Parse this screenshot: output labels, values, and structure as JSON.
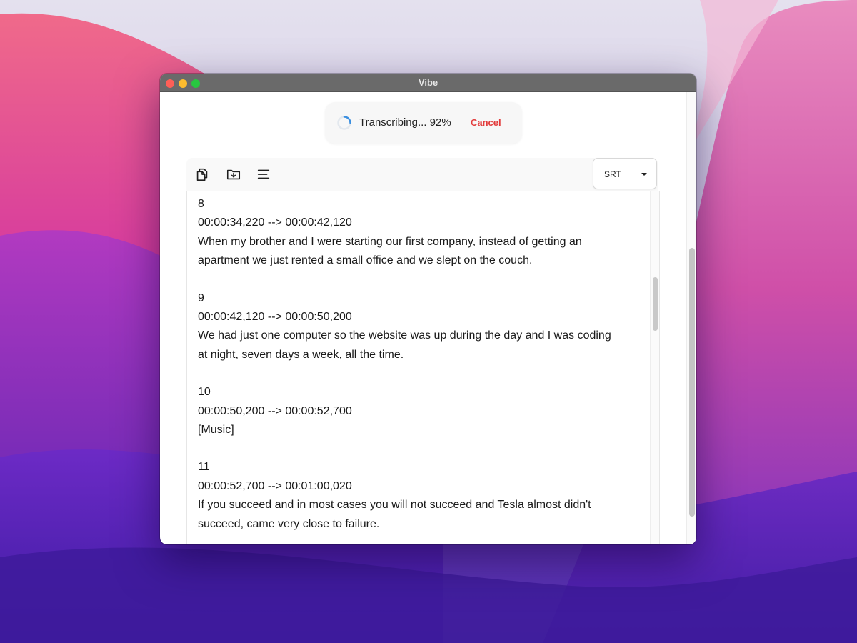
{
  "window": {
    "title": "Vibe"
  },
  "progress": {
    "label": "Transcribing... 92%",
    "percent": 92,
    "cancel_label": "Cancel"
  },
  "toolbar": {
    "icons": [
      "copy-icon",
      "download-folder-icon",
      "text-align-icon"
    ],
    "format": {
      "selected": "SRT"
    }
  },
  "transcript": {
    "segments": [
      {
        "index": "8",
        "timing": "00:00:34,220 --> 00:00:42,120",
        "lines": [
          "When my brother and I were starting our first company, instead of getting an",
          "apartment we just rented a small office and we slept on the couch."
        ]
      },
      {
        "index": "9",
        "timing": "00:00:42,120 --> 00:00:50,200",
        "lines": [
          "We had just one computer so the website was up during the day and I was coding",
          "at night, seven days a week, all the time."
        ]
      },
      {
        "index": "10",
        "timing": "00:00:50,200 --> 00:00:52,700",
        "lines": [
          "[Music]"
        ]
      },
      {
        "index": "11",
        "timing": "00:00:52,700 --> 00:01:00,020",
        "lines": [
          "If you succeed and in most cases you will not succeed and Tesla almost didn't",
          "succeed, came very close to failure."
        ]
      }
    ]
  },
  "colors": {
    "accent": "#3b8fe0",
    "cancel": "#e23b3b",
    "titlebar": "#6a6a6a"
  }
}
